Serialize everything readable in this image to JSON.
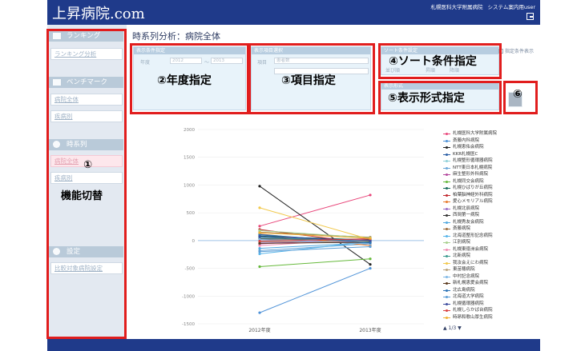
{
  "header": {
    "logo": "上昇病院.com",
    "hospital": "札幌医科大学附属病院",
    "user": "システム案内用user"
  },
  "page_title": "時系列分析：病院全体",
  "sidebar": {
    "sections": [
      {
        "title": "ランキング",
        "icon": "bar-chart-icon",
        "items": [
          "ランキング分析"
        ]
      },
      {
        "title": "ベンチマーク",
        "icon": "benchmark-icon",
        "items": [
          "病院全体",
          "疾病別"
        ]
      },
      {
        "title": "時系列",
        "icon": "clock-icon",
        "items": [
          "病院全体",
          "疾病別"
        ]
      },
      {
        "title": "設定",
        "icon": "gear-icon",
        "items": [
          "比較対象病院設定"
        ]
      }
    ]
  },
  "panels": {
    "year": {
      "header": "表示条件指定",
      "label": "年度",
      "from": "2012",
      "sep": "～",
      "to": "2013"
    },
    "item": {
      "header": "表示項目選択",
      "label": "項目",
      "value": "患者数",
      "value2": ""
    },
    "sort": {
      "header": "ソート条件設定",
      "label": "並び順",
      "opt1": "昇順",
      "opt2": "降順"
    },
    "format": {
      "header": "表示形式"
    },
    "view_option": "指定条件表示"
  },
  "annotations": {
    "a1": "①",
    "a1_text": "機能切替",
    "a2": "②年度指定",
    "a3": "③項目指定",
    "a4": "④ソート条件指定",
    "a5": "⑤表示形式指定",
    "a6": "⑥"
  },
  "legend_page": "▲ 1/3 ▼",
  "chart_data": {
    "type": "line",
    "categories": [
      "2012年度",
      "2013年度"
    ],
    "ylim": [
      -1500,
      2000
    ],
    "yticks": [
      2000,
      1500,
      1000,
      500,
      0,
      -500,
      -1000,
      -1500
    ],
    "series": [
      {
        "name": "札幌医科大学附属病院",
        "color": "#e8467a",
        "values": [
          260,
          820
        ]
      },
      {
        "name": "斎藤内科病院",
        "color": "#4f93d8",
        "values": [
          -1300,
          -500
        ]
      },
      {
        "name": "札幌恵佑会病院",
        "color": "#222222",
        "values": [
          980,
          -430
        ]
      },
      {
        "name": "KKR札幌医C",
        "color": "#2b5fa6",
        "values": [
          100,
          -30
        ]
      },
      {
        "name": "札幌整形循環器病院",
        "color": "#8fd0d8",
        "values": [
          40,
          20
        ]
      },
      {
        "name": "NTT東日本札幌病院",
        "color": "#6aa7d8",
        "values": [
          -180,
          -60
        ]
      },
      {
        "name": "麻生整形外科病院",
        "color": "#b5499e",
        "values": [
          -60,
          40
        ]
      },
      {
        "name": "札幌同交会病院",
        "color": "#66b93b",
        "values": [
          -470,
          -330
        ]
      },
      {
        "name": "札幌ひばりが丘病院",
        "color": "#176a5a",
        "values": [
          80,
          10
        ]
      },
      {
        "name": "柏葉脳神経外科病院",
        "color": "#c1272d",
        "values": [
          200,
          -60
        ]
      },
      {
        "name": "愛心メモリアル病院",
        "color": "#e87b2c",
        "values": [
          120,
          -90
        ]
      },
      {
        "name": "札幌北辰病院",
        "color": "#9b6bc6",
        "values": [
          -30,
          -20
        ]
      },
      {
        "name": "西岡第一病院",
        "color": "#333333",
        "values": [
          30,
          10
        ]
      },
      {
        "name": "札幌秀友会病院",
        "color": "#52a9e0",
        "values": [
          -140,
          -40
        ]
      },
      {
        "name": "斎藤病院",
        "color": "#9c6b3a",
        "values": [
          150,
          60
        ]
      },
      {
        "name": "北海道整形記念病院",
        "color": "#56b4e9",
        "values": [
          -240,
          -20
        ]
      },
      {
        "name": "江別病院",
        "color": "#a8d08d",
        "values": [
          180,
          50
        ]
      },
      {
        "name": "札幌東徳洲会病院",
        "color": "#f08ab0",
        "values": [
          -90,
          30
        ]
      },
      {
        "name": "北新病院",
        "color": "#3c9a8f",
        "values": [
          60,
          -20
        ]
      },
      {
        "name": "我汝会えにわ病院",
        "color": "#f2c94c",
        "values": [
          590,
          20
        ]
      },
      {
        "name": "東苗穂病院",
        "color": "#b9a27b",
        "values": [
          -20,
          -10
        ]
      },
      {
        "name": "中村記念病院",
        "color": "#7fb8e6",
        "values": [
          20,
          -60
        ]
      },
      {
        "name": "新札幌恵愛会病院",
        "color": "#5b3a1e",
        "values": [
          -50,
          -30
        ]
      },
      {
        "name": "北広島病院",
        "color": "#2c73b6",
        "values": [
          110,
          -40
        ]
      },
      {
        "name": "北海道大学病院",
        "color": "#5e9fd6",
        "values": [
          -200,
          -110
        ]
      },
      {
        "name": "札幌循環器病院",
        "color": "#3b4a9e",
        "values": [
          70,
          0
        ]
      },
      {
        "name": "札幌しらかば台病院",
        "color": "#d94040",
        "values": [
          -10,
          30
        ]
      },
      {
        "name": "時昂和歌山厚生病院",
        "color": "#f0b030",
        "values": [
          140,
          40
        ]
      }
    ]
  }
}
